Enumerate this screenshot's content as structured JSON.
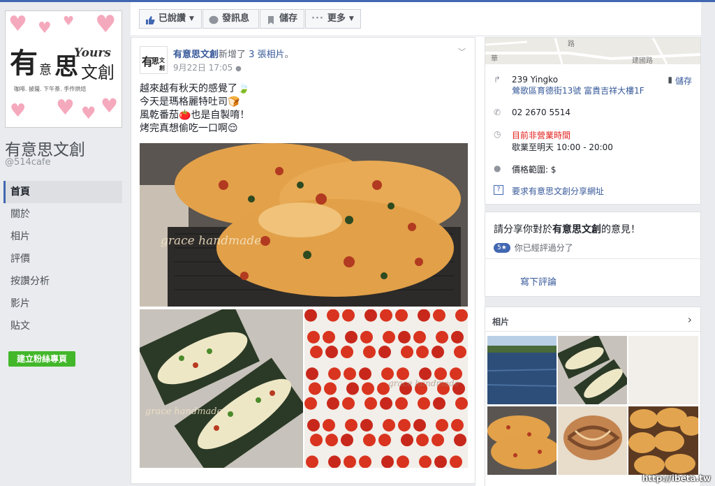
{
  "page": {
    "name": "有意思文創",
    "handle": "@514cafe",
    "logo_text": {
      "main1": "有",
      "main2": "意",
      "main3": "思",
      "main4": "文創",
      "yours": "Yours",
      "tagline": "咖啡. 披薩. 下午茶. 手作烘焙"
    }
  },
  "nav": {
    "items": [
      {
        "label": "首頁",
        "active": true
      },
      {
        "label": "關於"
      },
      {
        "label": "相片"
      },
      {
        "label": "評價"
      },
      {
        "label": "按讚分析"
      },
      {
        "label": "影片"
      },
      {
        "label": "貼文"
      }
    ],
    "create_button": "建立粉絲專頁"
  },
  "actionbar": {
    "liked": "已說讚",
    "message": "發訊息",
    "save": "儲存",
    "more": "更多"
  },
  "post": {
    "author": "有意思文創",
    "action": "新增了",
    "count": "3 張相片",
    "period": "。",
    "time": "9月22日 17:05",
    "lines": [
      "越來越有秋天的感覺了🍃",
      "今天是瑪格麗特吐司🍞",
      "風乾番茄🍅也是自製唷！",
      "烤完真想偷吃一口啊😌"
    ],
    "watermark": "grace handmade"
  },
  "info": {
    "address_line1": "239 Yingko",
    "address_line2": "鶯歌區育德街13號 富貴吉祥大樓1F",
    "save": "儲存",
    "phone": "02 2670 5514",
    "hours_status": "目前非營業時間",
    "hours": "歇業至明天 10:00 - 20:00",
    "price": "價格範圍: $",
    "ask_url": "要求有意思文創分享網址",
    "map_label_1": "華",
    "map_label_2": "路",
    "map_label_3": "建國路"
  },
  "review": {
    "prompt_prefix": "請分享你對於",
    "prompt_name": "有意思文創",
    "prompt_suffix": "的意見！",
    "badge": "5★",
    "rated": "你已經評過分了",
    "write": "寫下評論"
  },
  "photos": {
    "title": "相片"
  },
  "watermark_site": "http://ibeta.tw",
  "colors": {
    "brand": "#4267b2",
    "link": "#365899",
    "green": "#42b72a",
    "red": "#e0201b"
  }
}
